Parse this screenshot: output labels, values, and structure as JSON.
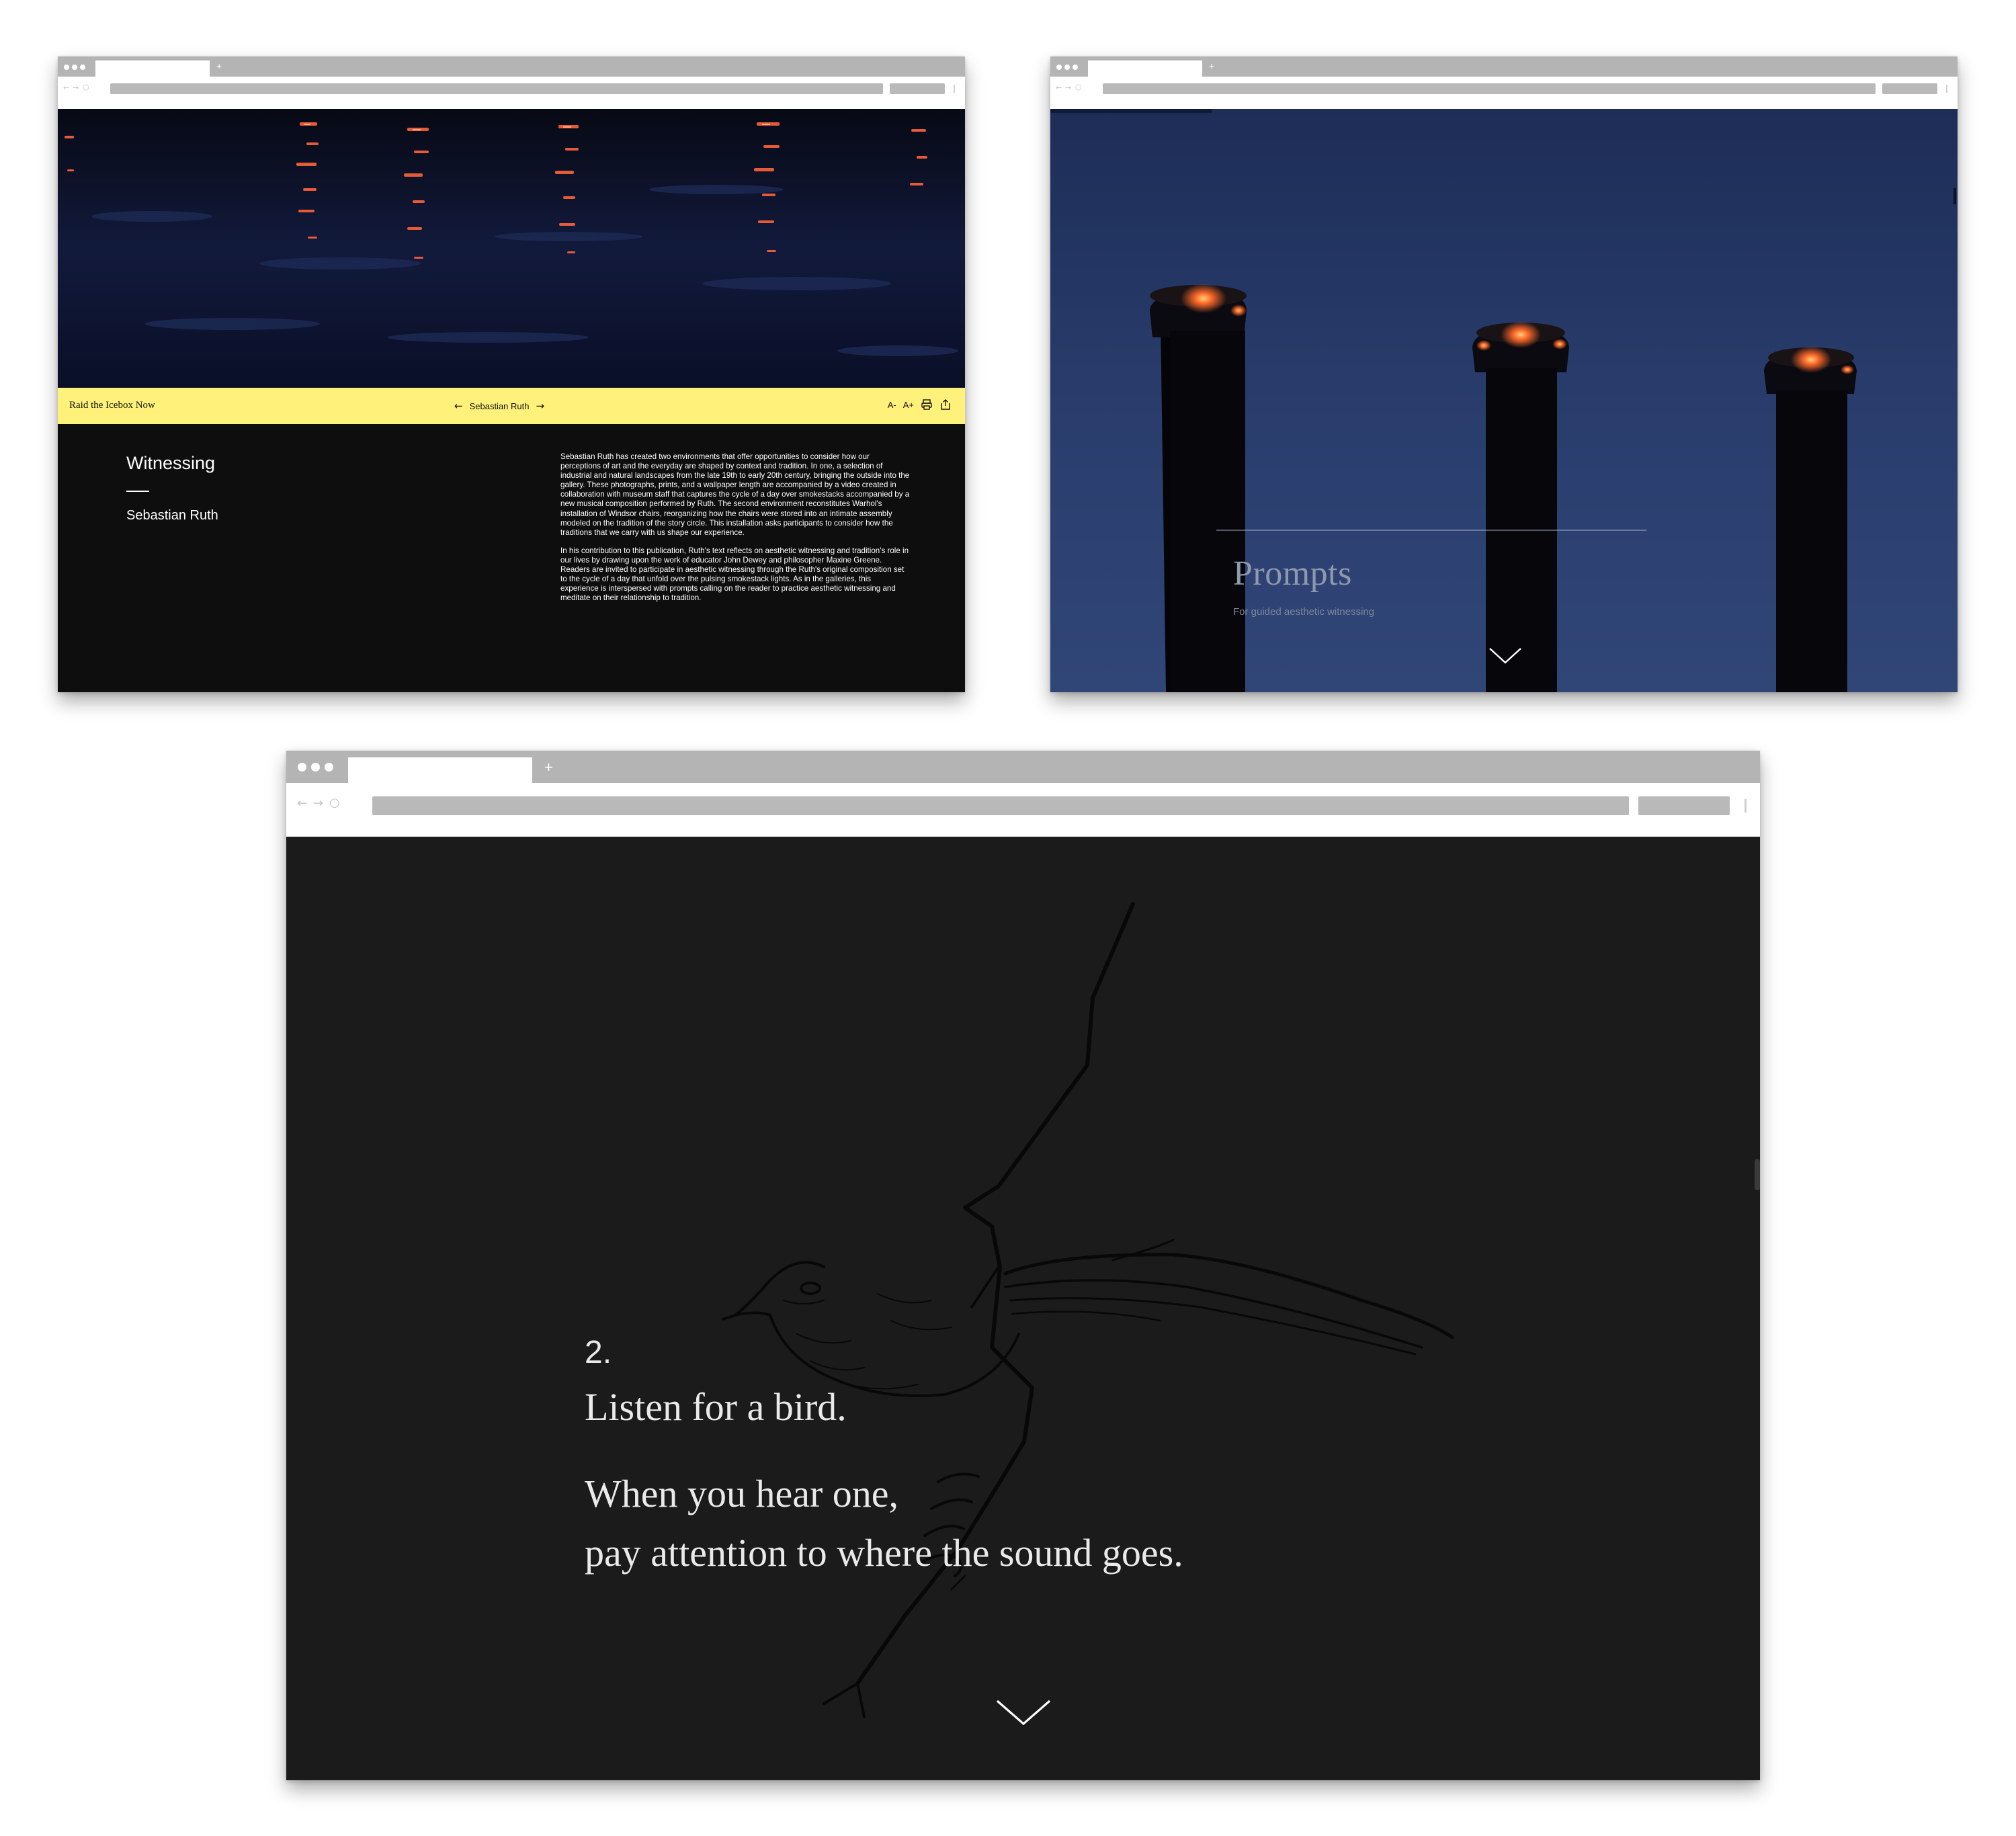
{
  "window1": {
    "header": {
      "site_title": "Raid the Icebox Now",
      "prev_arrow": "←",
      "author_nav": "Sebastian Ruth",
      "next_arrow": "→",
      "font_decrease": "A-",
      "font_increase": "A+"
    },
    "essay": {
      "title": "Witnessing",
      "author": "Sebastian Ruth",
      "paragraphs": [
        "Sebastian Ruth has created two environments that offer opportunities to consider how our perceptions of art and the everyday are shaped by context and tradition. In one, a selection of industrial and natural landscapes from the late 19th to early 20th century, bringing the outside into the gallery. These photographs, prints, and a wallpaper length are accompanied by a video created in collaboration with museum staff that captures the cycle of a day over smokestacks accompanied by a new musical composition performed by Ruth. The second environment reconstitutes Warhol's installation of Windsor chairs, reorganizing how the chairs were stored into an intimate assembly modeled on the tradition of the story circle. This installation asks participants to consider how the traditions that we carry with us shape our experience.",
        "In his contribution to this publication, Ruth's text reflects on aesthetic witnessing and tradition's role in our lives by drawing upon the work of educator John Dewey and philosopher Maxine Greene. Readers are invited to participate in aesthetic witnessing through the Ruth's original composition set to the cycle of a day that unfold over the pulsing smokestack lights. As in the galleries, this experience is interspersed with prompts calling on the reader to practice aesthetic witnessing and meditate on their relationship to tradition."
      ]
    }
  },
  "window2": {
    "title": "Prompts",
    "subtitle": "For guided aesthetic witnessing"
  },
  "window3": {
    "prompt_number": "2.",
    "line1": "Listen for a bird.",
    "line2": "When you hear one,",
    "line3": "pay attention to where the sound goes."
  },
  "browser": {
    "new_tab_label": "+",
    "back_glyph": "←",
    "forward_glyph": "→",
    "reload_glyph": "○"
  },
  "colors": {
    "highlight_yellow": "#fff17a",
    "chrome_gray": "#b4b4b4",
    "dark_bg": "#1b1b1b",
    "sky_blue": "#2a3e6e",
    "smokestack_glow": "#ff6a2a"
  }
}
